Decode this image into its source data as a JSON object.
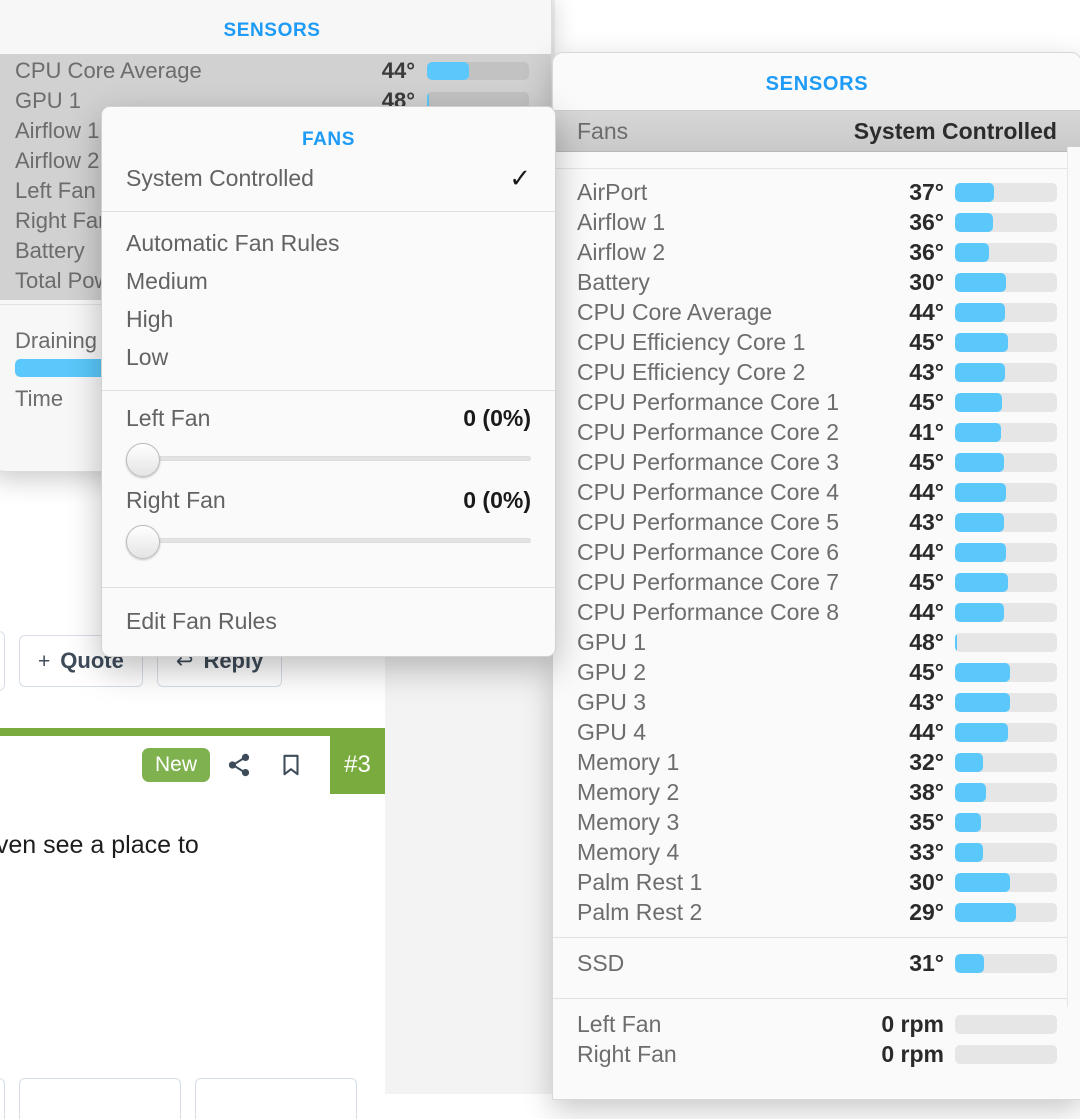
{
  "web_page": {
    "actions": [
      {
        "label": "Quote",
        "glyph": "+",
        "name": "quote-button"
      },
      {
        "label": "Reply",
        "glyph": "↩",
        "name": "reply-button"
      }
    ],
    "badge_new": "New",
    "post_number": "#3",
    "post_text": "even see a place to",
    "share_icon": "share-icon",
    "bookmark_icon": "bookmark-icon",
    "accent_green": "#7aab3e",
    "badge_green": "#7fb14e"
  },
  "left_panel": {
    "title": "SENSORS",
    "rows": [
      {
        "name": "CPU Core Average",
        "value": "44°",
        "fill": 41
      },
      {
        "name": "GPU 1",
        "value": "48°",
        "fill": 2
      },
      {
        "name": "Airflow 1",
        "value": "",
        "fill": 0
      },
      {
        "name": "Airflow 2",
        "value": "",
        "fill": 0
      },
      {
        "name": "Left Fan",
        "value": "",
        "fill": 0
      },
      {
        "name": "Right Fan",
        "value": "",
        "fill": 0
      },
      {
        "name": "Battery",
        "value": "",
        "fill": 0
      },
      {
        "name": "Total Power",
        "value": "",
        "fill": 0
      }
    ],
    "lower": {
      "draining_label": "Draining",
      "time_label": "Time",
      "drain_fill": 100
    }
  },
  "fans_menu": {
    "title": "FANS",
    "selected_item": {
      "label": "System Controlled",
      "checkmark": "✓"
    },
    "presets": [
      "Automatic Fan Rules",
      "Medium",
      "High",
      "Low"
    ],
    "sliders": [
      {
        "label": "Left Fan",
        "value": "0 (0%)",
        "position": 0
      },
      {
        "label": "Right Fan",
        "value": "0 (0%)",
        "position": 0
      }
    ],
    "footer": "Edit Fan Rules"
  },
  "sensors_panel": {
    "title": "SENSORS",
    "header": {
      "left": "Fans",
      "right": "System Controlled"
    },
    "temperatures": [
      {
        "name": "AirPort",
        "value": "37°",
        "fill": 38
      },
      {
        "name": "Airflow 1",
        "value": "36°",
        "fill": 37
      },
      {
        "name": "Airflow 2",
        "value": "36°",
        "fill": 33
      },
      {
        "name": "Battery",
        "value": "30°",
        "fill": 50
      },
      {
        "name": "CPU Core Average",
        "value": "44°",
        "fill": 49
      },
      {
        "name": "CPU Efficiency Core 1",
        "value": "45°",
        "fill": 52
      },
      {
        "name": "CPU Efficiency Core 2",
        "value": "43°",
        "fill": 49
      },
      {
        "name": "CPU Performance Core 1",
        "value": "45°",
        "fill": 46
      },
      {
        "name": "CPU Performance Core 2",
        "value": "41°",
        "fill": 45
      },
      {
        "name": "CPU Performance Core 3",
        "value": "45°",
        "fill": 48
      },
      {
        "name": "CPU Performance Core 4",
        "value": "44°",
        "fill": 50
      },
      {
        "name": "CPU Performance Core 5",
        "value": "43°",
        "fill": 48
      },
      {
        "name": "CPU Performance Core 6",
        "value": "44°",
        "fill": 50
      },
      {
        "name": "CPU Performance Core 7",
        "value": "45°",
        "fill": 52
      },
      {
        "name": "CPU Performance Core 8",
        "value": "44°",
        "fill": 48
      },
      {
        "name": "GPU 1",
        "value": "48°",
        "fill": 2
      },
      {
        "name": "GPU 2",
        "value": "45°",
        "fill": 54
      },
      {
        "name": "GPU 3",
        "value": "43°",
        "fill": 54
      },
      {
        "name": "GPU 4",
        "value": "44°",
        "fill": 52
      },
      {
        "name": "Memory 1",
        "value": "32°",
        "fill": 27
      },
      {
        "name": "Memory 2",
        "value": "38°",
        "fill": 30
      },
      {
        "name": "Memory 3",
        "value": "35°",
        "fill": 25
      },
      {
        "name": "Memory 4",
        "value": "33°",
        "fill": 27
      },
      {
        "name": "Palm Rest 1",
        "value": "30°",
        "fill": 54
      },
      {
        "name": "Palm Rest 2",
        "value": "29°",
        "fill": 60
      }
    ],
    "drives": [
      {
        "name": "SSD",
        "value": "31°",
        "fill": 28
      }
    ],
    "fans": [
      {
        "name": "Left Fan",
        "value": "0 rpm",
        "fill": 0
      },
      {
        "name": "Right Fan",
        "value": "0 rpm",
        "fill": 0
      }
    ]
  },
  "colors": {
    "accent_blue": "#1d9bf6",
    "bar_blue": "#5ac8fa",
    "bar_track": "#e6e6e6"
  }
}
